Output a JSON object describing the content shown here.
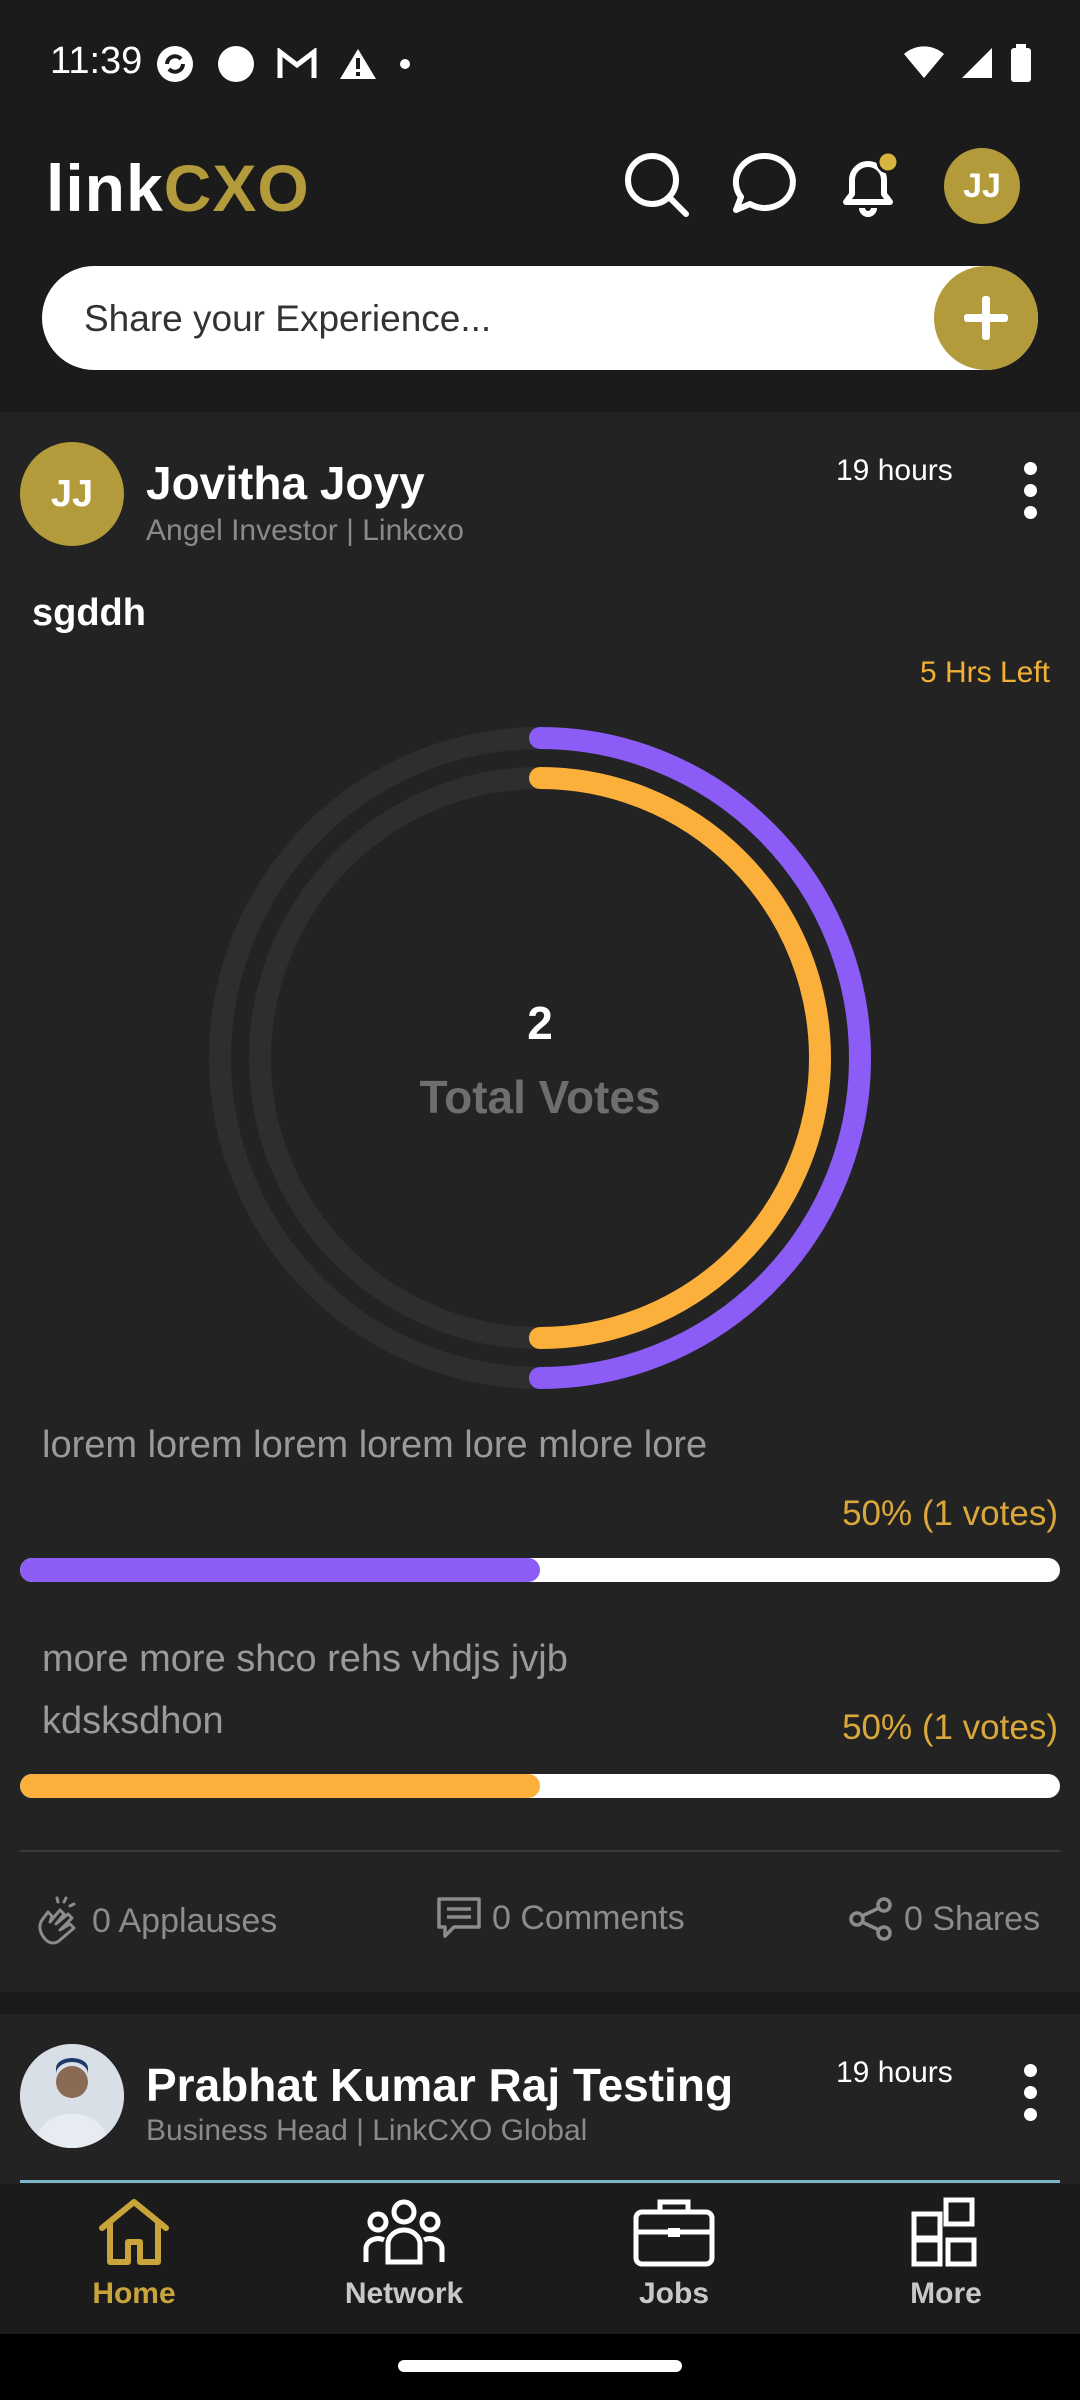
{
  "status_bar": {
    "time": "11:39"
  },
  "header": {
    "logo_part1": "link",
    "logo_part2": "CXO",
    "avatar_initials": "JJ",
    "share_placeholder": "Share your Experience...",
    "accent_color": "#b39b3b"
  },
  "post": {
    "avatar_initials": "JJ",
    "author": "Jovitha Joyy",
    "subtitle": "Angel Investor | Linkcxo",
    "time": "19 hours",
    "poll_title": "sgddh",
    "time_left": "5 Hrs Left",
    "total_votes": "2",
    "total_votes_label": "Total Votes",
    "options": [
      {
        "text": "lorem lorem lorem lorem lore mlore lore",
        "percent_label": "50% (1 votes)",
        "fraction": 0.5,
        "color": "#8b5cf6"
      },
      {
        "text": "more more shco rehs vhdjs jvjb kdsksdhon",
        "percent_label": "50% (1 votes)",
        "fraction": 0.5,
        "color": "#fbb03b"
      }
    ],
    "actions": {
      "applauses": "0 Applauses",
      "comments": "0 Comments",
      "shares": "0 Shares"
    }
  },
  "post2": {
    "author": "Prabhat Kumar Raj Testing",
    "subtitle": "Business Head | LinkCXO Global",
    "time": "19 hours"
  },
  "bottom_nav": {
    "items": [
      {
        "label": "Home",
        "icon": "home-icon",
        "active": true
      },
      {
        "label": "Network",
        "icon": "network-icon",
        "active": false
      },
      {
        "label": "Jobs",
        "icon": "briefcase-icon",
        "active": false
      },
      {
        "label": "More",
        "icon": "grid-icon",
        "active": false
      }
    ]
  }
}
